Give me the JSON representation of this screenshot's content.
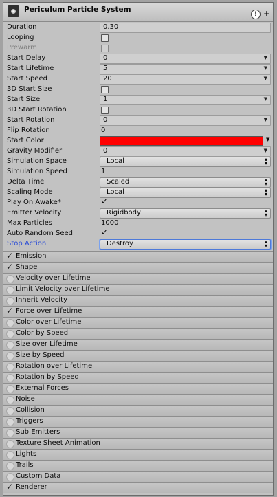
{
  "header": {
    "title": "Periculum Particle System",
    "help_icon": "!",
    "add_icon": "+"
  },
  "fields": [
    {
      "label": "Duration",
      "kind": "text",
      "value": "0.30"
    },
    {
      "label": "Looping",
      "kind": "checkbox",
      "checked": false
    },
    {
      "label": "Prewarm",
      "kind": "checkbox",
      "checked": false,
      "disabled": true
    },
    {
      "label": "Start Delay",
      "kind": "curve",
      "value": "0"
    },
    {
      "label": "Start Lifetime",
      "kind": "curve",
      "value": "5"
    },
    {
      "label": "Start Speed",
      "kind": "curve",
      "value": "20"
    },
    {
      "label": "3D Start Size",
      "kind": "checkbox",
      "checked": false
    },
    {
      "label": "Start Size",
      "kind": "curve",
      "value": "1"
    },
    {
      "label": "3D Start Rotation",
      "kind": "checkbox",
      "checked": false
    },
    {
      "label": "Start Rotation",
      "kind": "curve",
      "value": "0"
    },
    {
      "label": "Flip Rotation",
      "kind": "plain",
      "value": "0"
    },
    {
      "label": "Start Color",
      "kind": "color",
      "color": "#ff0000"
    },
    {
      "label": "Gravity Modifier",
      "kind": "curve",
      "value": "0"
    },
    {
      "label": "Simulation Space",
      "kind": "dropdown",
      "value": "Local"
    },
    {
      "label": "Simulation Speed",
      "kind": "plain",
      "value": "1"
    },
    {
      "label": "Delta Time",
      "kind": "dropdown",
      "value": "Scaled"
    },
    {
      "label": "Scaling Mode",
      "kind": "dropdown",
      "value": "Local"
    },
    {
      "label": "Play On Awake*",
      "kind": "checkmark",
      "checked": true
    },
    {
      "label": "Emitter Velocity",
      "kind": "dropdown",
      "value": "Rigidbody"
    },
    {
      "label": "Max Particles",
      "kind": "plain",
      "value": "1000"
    },
    {
      "label": "Auto Random Seed",
      "kind": "checkmark",
      "checked": true
    },
    {
      "label": "Stop Action",
      "kind": "dropdown",
      "value": "Destroy",
      "highlight": true
    }
  ],
  "modules": [
    {
      "label": "Emission",
      "enabled": true
    },
    {
      "label": "Shape",
      "enabled": true
    },
    {
      "label": "Velocity over Lifetime",
      "enabled": false
    },
    {
      "label": "Limit Velocity over Lifetime",
      "enabled": false
    },
    {
      "label": "Inherit Velocity",
      "enabled": false
    },
    {
      "label": "Force over Lifetime",
      "enabled": true
    },
    {
      "label": "Color over Lifetime",
      "enabled": false
    },
    {
      "label": "Color by Speed",
      "enabled": false
    },
    {
      "label": "Size over Lifetime",
      "enabled": false
    },
    {
      "label": "Size by Speed",
      "enabled": false
    },
    {
      "label": "Rotation over Lifetime",
      "enabled": false
    },
    {
      "label": "Rotation by Speed",
      "enabled": false
    },
    {
      "label": "External Forces",
      "enabled": false
    },
    {
      "label": "Noise",
      "enabled": false
    },
    {
      "label": "Collision",
      "enabled": false
    },
    {
      "label": "Triggers",
      "enabled": false
    },
    {
      "label": "Sub Emitters",
      "enabled": false
    },
    {
      "label": "Texture Sheet Animation",
      "enabled": false
    },
    {
      "label": "Lights",
      "enabled": false
    },
    {
      "label": "Trails",
      "enabled": false
    },
    {
      "label": "Custom Data",
      "enabled": false
    },
    {
      "label": "Renderer",
      "enabled": true
    }
  ],
  "colors": {
    "label_highlight": "#2e4fd6",
    "start_color": "#ff0000"
  }
}
